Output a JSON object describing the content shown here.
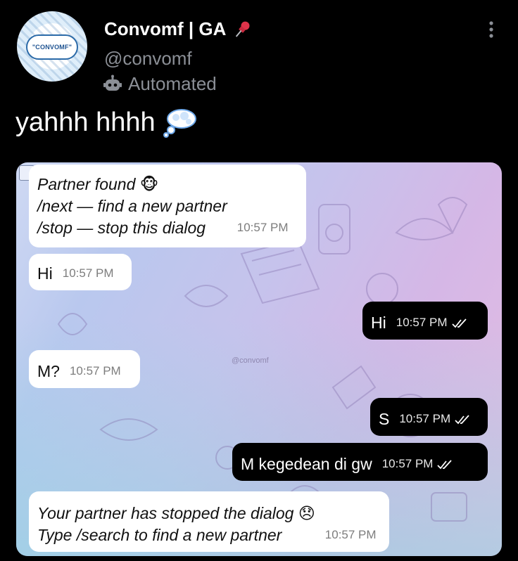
{
  "profile": {
    "name": "Convomf | GA",
    "handle": "@convomf",
    "badge_label": "Automated",
    "avatar_text": "\"CONVOMF\"",
    "pin_icon": "pushpin-icon",
    "badge_icon": "robot-icon"
  },
  "tweet": {
    "text": "yahhh hhhh",
    "emoji": "thought-balloon-icon"
  },
  "chat": {
    "watermark": "@convomf",
    "messages": [
      {
        "side": "in",
        "lines": [
          "Partner found 🐵",
          "/next — find a new partner",
          "/stop — stop this dialog"
        ],
        "time": "10:57 PM"
      },
      {
        "side": "in",
        "lines": [
          "Hi"
        ],
        "time": "10:57 PM"
      },
      {
        "side": "out",
        "lines": [
          "Hi"
        ],
        "time": "10:57 PM"
      },
      {
        "side": "in",
        "lines": [
          "M?"
        ],
        "time": "10:57 PM"
      },
      {
        "side": "out",
        "lines": [
          "S"
        ],
        "time": "10:57 PM"
      },
      {
        "side": "out",
        "lines": [
          "M kegedean di gw"
        ],
        "time": "10:57 PM"
      },
      {
        "side": "in",
        "lines": [
          "Your partner has stopped the dialog 😞",
          "Type /search to find a new partner"
        ],
        "time": "10:57 PM"
      }
    ]
  },
  "colors": {
    "background": "#000000",
    "secondary_text": "#8b8f96",
    "incoming_bubble": "#ffffff",
    "outgoing_bubble": "#000000"
  }
}
